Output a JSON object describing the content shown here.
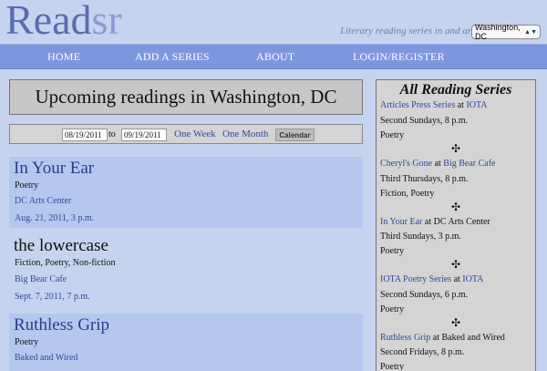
{
  "header": {
    "logo_read": "Read",
    "logo_sr": "sr",
    "tagline": "Literary reading series in and around",
    "city": "Washington, DC"
  },
  "nav": [
    "HOME",
    "ADD A SERIES",
    "ABOUT",
    "LOGIN/REGISTER"
  ],
  "main": {
    "title": "Upcoming readings in Washington, DC",
    "filter": {
      "from": "08/19/2011",
      "to_label": "to",
      "to": "09/19/2011",
      "one_week": "One Week",
      "one_month": "One Month",
      "calendar": "Calendar"
    },
    "readings": [
      {
        "title": "In Your Ear",
        "genre": "Poetry",
        "venue": "DC Arts Center",
        "date": "Aug. 21, 2011, 3 p.m."
      },
      {
        "title": "the lowercase",
        "genre": "Fiction, Poetry, Non-fiction",
        "venue": "Big Bear Cafe",
        "date": "Sept. 7, 2011, 7 p.m."
      },
      {
        "title": "Ruthless Grip",
        "genre": "Poetry",
        "venue": "Baked and Wired",
        "date": ""
      }
    ]
  },
  "sidebar": {
    "title": "All Reading Series",
    "at": "at",
    "separator": "✣",
    "series": [
      {
        "name": "Articles Press Series",
        "venue": "IOTA",
        "venue_link": true,
        "schedule": "Second Sundays, 8 p.m.",
        "genre": "Poetry"
      },
      {
        "name": "Cheryl's Gone",
        "venue": "Big Bear Cafe",
        "venue_link": true,
        "schedule": "Third Thursdays, 8 p.m.",
        "genre": "Fiction, Poetry"
      },
      {
        "name": "In Your Ear",
        "venue": "DC Arts Center",
        "venue_link": false,
        "schedule": "Third Sundays, 3 p.m.",
        "genre": "Poetry"
      },
      {
        "name": "IOTA Poetry Series",
        "venue": "IOTA",
        "venue_link": true,
        "schedule": "Second Sundays, 6 p.m.",
        "genre": "Poetry"
      },
      {
        "name": "Ruthless Grip",
        "venue": "Baked and Wired",
        "venue_link": false,
        "schedule": "Second Fridays, 8 p.m.",
        "genre": "Poetry"
      }
    ]
  }
}
